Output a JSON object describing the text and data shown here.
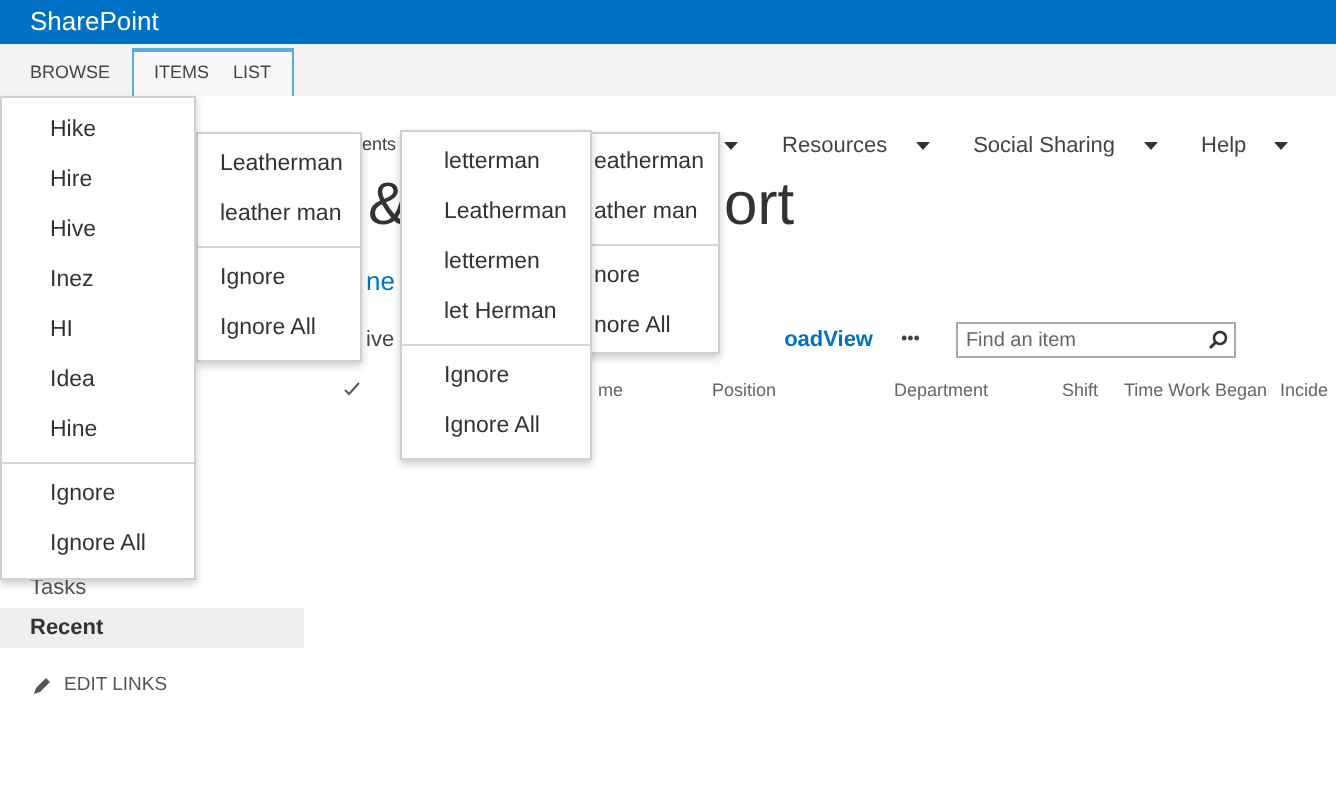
{
  "app": {
    "title": "SharePoint"
  },
  "ribbon": {
    "tabs": [
      {
        "label": "BROWSE"
      }
    ],
    "tab_group": {
      "tabs": [
        {
          "label": "ITEMS"
        },
        {
          "label": "LIST"
        }
      ]
    }
  },
  "top_nav": [
    {
      "label": "ents"
    },
    {
      "label": "Resources"
    },
    {
      "label": "Social Sharing"
    },
    {
      "label": "Help"
    }
  ],
  "title_parts": [
    "&",
    "ort"
  ],
  "subtitle": "ne",
  "toolbar": {
    "view_fragment": "ive",
    "link": "oadView",
    "more": "•••",
    "search": {
      "placeholder": "Find an item"
    }
  },
  "columns": [
    "me",
    "Position",
    "Department",
    "Shift",
    "Time Work Began",
    "Incide"
  ],
  "left_nav": [
    {
      "label": "Tasks",
      "selected": false
    },
    {
      "label": "Recent",
      "selected": true
    }
  ],
  "edit_links": "EDIT LINKS",
  "menus": [
    {
      "suggestions": [
        "Hike",
        "Hire",
        "Hive",
        "Inez",
        "HI",
        "Idea",
        "Hine"
      ],
      "actions": [
        "Ignore",
        "Ignore All"
      ]
    },
    {
      "suggestions": [
        "Leatherman",
        "leather man"
      ],
      "actions": [
        "Ignore",
        "Ignore All"
      ]
    },
    {
      "suggestions": [
        "letterman",
        "Leatherman",
        "lettermen",
        "let Herman"
      ],
      "actions": [
        "Ignore",
        "Ignore All"
      ]
    },
    {
      "suggestions": [
        "eatherman",
        "ather man"
      ],
      "actions": [
        "nore",
        "nore All"
      ]
    }
  ]
}
